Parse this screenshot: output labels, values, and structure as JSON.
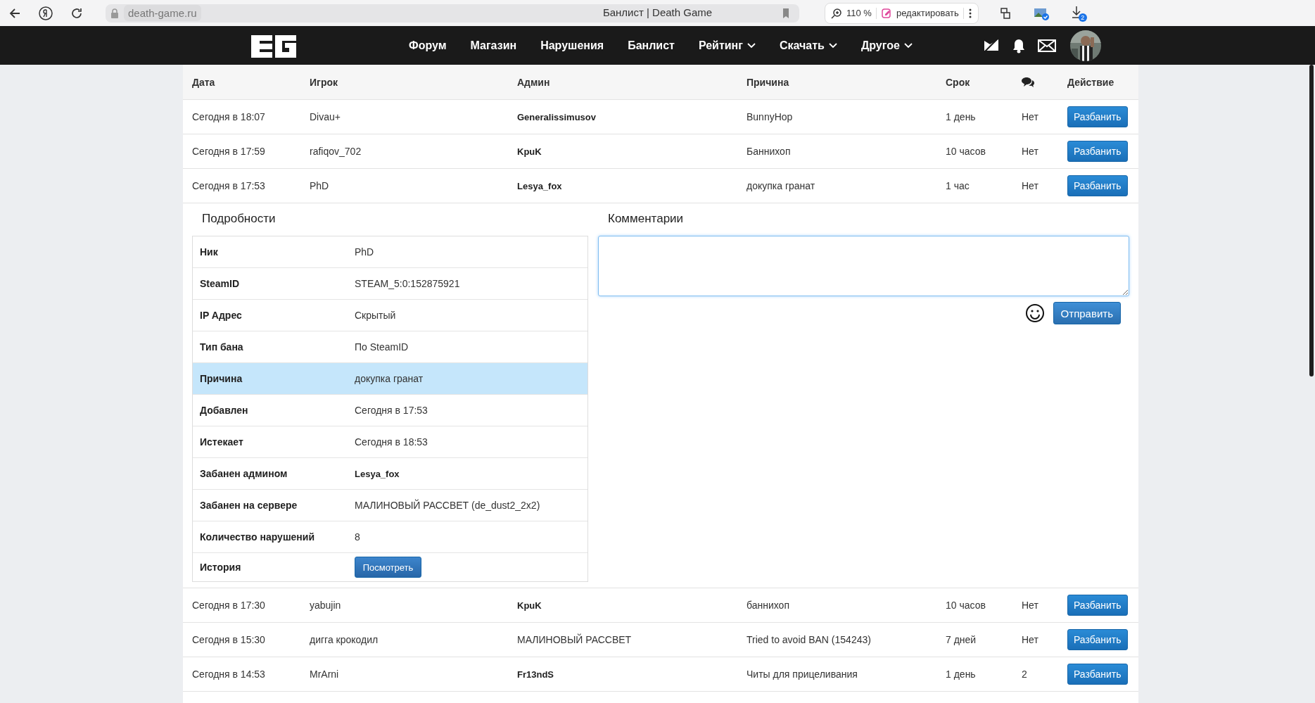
{
  "browser": {
    "url": "death-game.ru",
    "title": "Банлист | Death Game",
    "zoom": "110 %",
    "edit_label": "редактировать",
    "downloads": "2"
  },
  "nav": {
    "items": [
      {
        "label": "Форум",
        "dropdown": false
      },
      {
        "label": "Магазин",
        "dropdown": false
      },
      {
        "label": "Нарушения",
        "dropdown": false
      },
      {
        "label": "Банлист",
        "dropdown": false
      },
      {
        "label": "Рейтинг",
        "dropdown": true
      },
      {
        "label": "Скачать",
        "dropdown": true
      },
      {
        "label": "Другое",
        "dropdown": true
      }
    ]
  },
  "table": {
    "columns": [
      {
        "kind": "text",
        "label": "Дата"
      },
      {
        "kind": "text",
        "label": "Игрок"
      },
      {
        "kind": "text",
        "label": "Админ"
      },
      {
        "kind": "text",
        "label": "Причина"
      },
      {
        "kind": "text",
        "label": "Срок"
      },
      {
        "kind": "icon"
      },
      {
        "kind": "text",
        "label": "Действие"
      }
    ],
    "rows": [
      {
        "date": "Сегодня в 18:07",
        "player": "Divau+",
        "admin": "Generalissimusov",
        "admin_bold": true,
        "reason": "BunnyHop",
        "term": "1 день",
        "comments": "Нет",
        "action": "Разбанить",
        "expanded": false
      },
      {
        "date": "Сегодня в 17:59",
        "player": "rafiqov_702",
        "admin": "KpuK",
        "admin_bold": true,
        "reason": "Баннихоп",
        "term": "10 часов",
        "comments": "Нет",
        "action": "Разбанить",
        "expanded": false
      },
      {
        "date": "Сегодня в 17:53",
        "player": "PhD",
        "admin": "Lesya_fox",
        "admin_bold": true,
        "reason": "докупка гранат",
        "term": "1 час",
        "comments": "Нет",
        "action": "Разбанить",
        "expanded": true
      },
      {
        "date": "Сегодня в 17:30",
        "player": "yabujin",
        "admin": "KpuK",
        "admin_bold": true,
        "reason": "баннихоп",
        "term": "10 часов",
        "comments": "Нет",
        "action": "Разбанить",
        "expanded": false
      },
      {
        "date": "Сегодня в 15:30",
        "player": "дигга крокодил",
        "admin": "МАЛИНОВЫЙ РАССВЕТ",
        "admin_bold": false,
        "reason": "Tried to avoid BAN (154243)",
        "term": "7 дней",
        "comments": "Нет",
        "action": "Разбанить",
        "expanded": false
      },
      {
        "date": "Сегодня в 14:53",
        "player": "MrArni",
        "admin": "Fr13ndS",
        "admin_bold": true,
        "reason": "Читы для прицеливания",
        "term": "1 день",
        "comments": "2",
        "action": "Разбанить",
        "expanded": false
      }
    ]
  },
  "details": {
    "title": "Подробности",
    "fields": [
      {
        "kind": "text",
        "label": "Ник",
        "value": "PhD",
        "selected": false
      },
      {
        "kind": "text",
        "label": "SteamID",
        "value": "STEAM_5:0:152875921",
        "selected": false
      },
      {
        "kind": "text",
        "label": "IP Адрес",
        "value": "Скрытый",
        "selected": false
      },
      {
        "kind": "text",
        "label": "Тип бана",
        "value": "По SteamID",
        "selected": false
      },
      {
        "kind": "text",
        "label": "Причина",
        "value": "докупка гранат",
        "selected": true
      },
      {
        "kind": "text",
        "label": "Добавлен",
        "value": "Сегодня в 17:53",
        "selected": false
      },
      {
        "kind": "text",
        "label": "Истекает",
        "value": "Сегодня в 18:53",
        "selected": false
      },
      {
        "kind": "bold",
        "label": "Забанен админом",
        "value": "Lesya_fox",
        "selected": false
      },
      {
        "kind": "text",
        "label": "Забанен на сервере",
        "value": "МАЛИНОВЫЙ РАССВЕТ (de_dust2_2x2)",
        "selected": false
      },
      {
        "kind": "text",
        "label": "Количество нарушений",
        "value": "8",
        "selected": false
      },
      {
        "kind": "button",
        "label": "История",
        "value": "Посмотреть",
        "selected": false
      }
    ],
    "comments": {
      "title": "Комментарии",
      "send": "Отправить"
    }
  }
}
